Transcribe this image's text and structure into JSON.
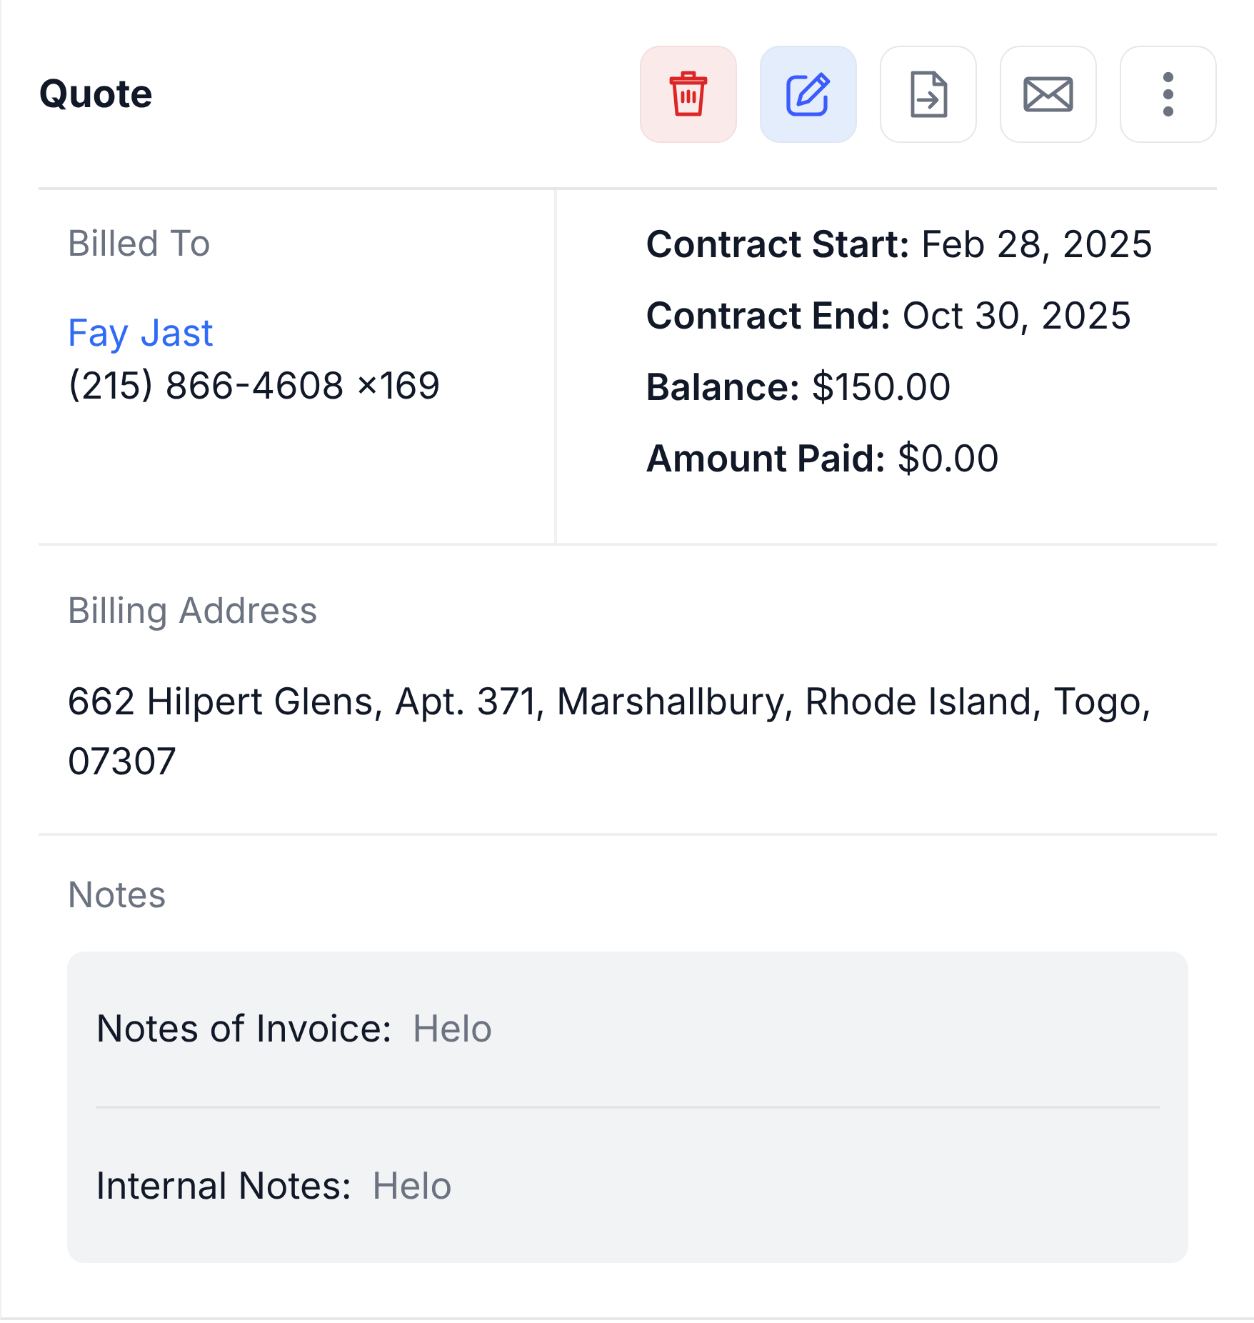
{
  "title": "Quote",
  "actions": [
    {
      "kind": "delete"
    },
    {
      "kind": "edit"
    },
    {
      "kind": "convert"
    },
    {
      "kind": "email"
    },
    {
      "kind": "more"
    }
  ],
  "billed_to": {
    "heading": "Billed To",
    "name": "Fay Jast",
    "phone": "(215) 866-4608 ×169"
  },
  "details": [
    {
      "label": "Contract Start:",
      "value": "Feb 28, 2025"
    },
    {
      "label": "Contract End:",
      "value": "Oct 30, 2025"
    },
    {
      "label": "Balance:",
      "value": "$150.00"
    },
    {
      "label": "Amount Paid:",
      "value": "$0.00"
    }
  ],
  "billing_address": {
    "heading": "Billing Address",
    "text": "662 Hilpert Glens, Apt. 371, Marshallbury, Rhode Island, Togo, 07307"
  },
  "notes": {
    "heading": "Notes",
    "items": [
      {
        "label": "Notes of Invoice:",
        "value": "Helo"
      },
      {
        "label": "Internal Notes:",
        "value": "Helo"
      }
    ]
  }
}
